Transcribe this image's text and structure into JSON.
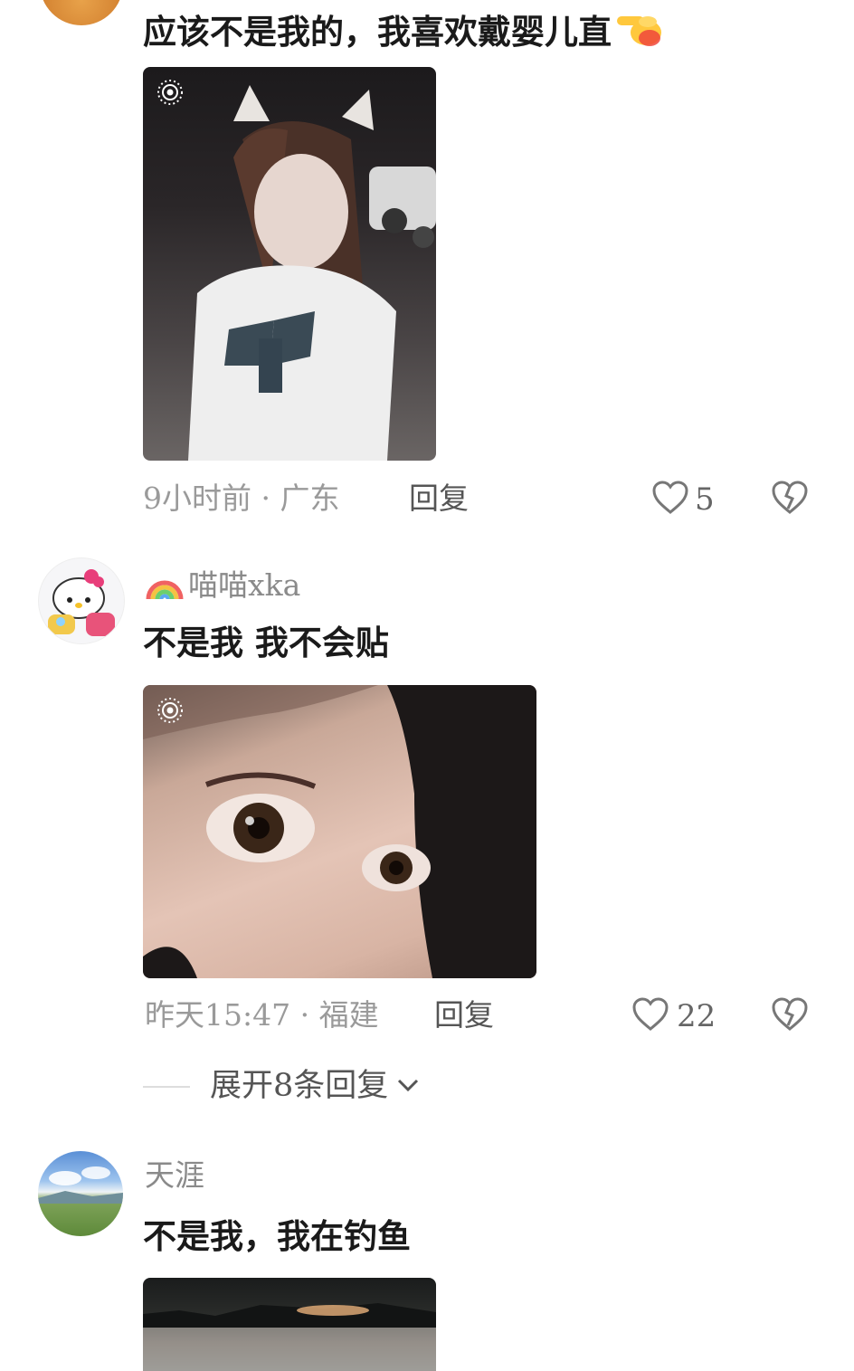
{
  "comments": [
    {
      "text": "应该不是我的，我喜欢戴婴儿直",
      "time_location": "9小时前 · 广东",
      "reply_label": "回复",
      "likes": "5"
    },
    {
      "username": "喵喵xka",
      "text": "不是我 我不会贴",
      "time_location": "昨天15:47 · 福建",
      "reply_label": "回复",
      "likes": "22",
      "expand_label": "展开8条回复"
    },
    {
      "username": "天涯",
      "text": "不是我，我在钓鱼"
    }
  ],
  "icons": {
    "like": "heart-outline-icon",
    "dislike": "broken-heart-icon",
    "live_photo": "live-photo-icon",
    "expand": "chevron-down-icon",
    "emoji": "pointing-hand-emoji"
  },
  "colors": {
    "text": "#1a1a1a",
    "meta": "#9a9a9a",
    "username": "#8a8a8a"
  }
}
